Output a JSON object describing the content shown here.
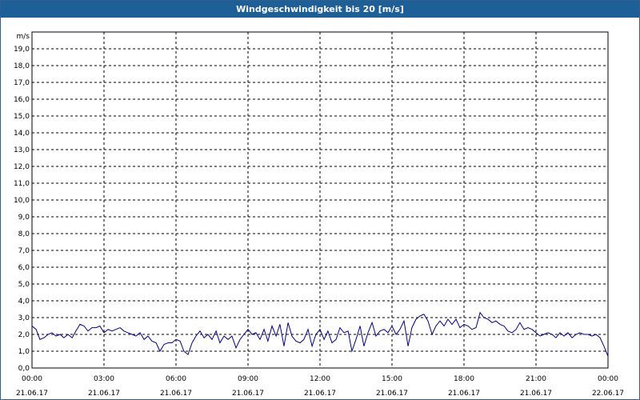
{
  "window": {
    "title": "Windgeschwindigkeit bis 20 [m/s]"
  },
  "colors": {
    "titlebar": "#1f5f97",
    "series": "#00008b",
    "grid": "#000000"
  },
  "chart_data": {
    "type": "line",
    "title": "Windgeschwindigkeit bis 20 [m/s]",
    "ylabel": "m/s",
    "ylim": [
      0,
      20
    ],
    "yticks": [
      "0,0",
      "1,0",
      "2,0",
      "3,0",
      "4,0",
      "5,0",
      "6,0",
      "7,0",
      "8,0",
      "9,0",
      "10,0",
      "11,0",
      "12,0",
      "13,0",
      "14,0",
      "15,0",
      "16,0",
      "17,0",
      "18,0",
      "19,0"
    ],
    "xlim_hours": [
      0,
      24
    ],
    "xticks": [
      {
        "time": "00:00",
        "date": "21.06.17"
      },
      {
        "time": "03:00",
        "date": "21.06.17"
      },
      {
        "time": "06:00",
        "date": "21.06.17"
      },
      {
        "time": "09:00",
        "date": "21.06.17"
      },
      {
        "time": "12:00",
        "date": "21.06.17"
      },
      {
        "time": "15:00",
        "date": "21.06.17"
      },
      {
        "time": "18:00",
        "date": "21.06.17"
      },
      {
        "time": "21:00",
        "date": "21.06.17"
      },
      {
        "time": "00:00",
        "date": "22.06.17"
      }
    ],
    "grid": true,
    "series": [
      {
        "x_hours": [
          0,
          0.17,
          0.33,
          0.5,
          0.67,
          0.83,
          1,
          1.17,
          1.33,
          1.5,
          1.67,
          1.83,
          2,
          2.17,
          2.33,
          2.5,
          2.67,
          2.83,
          3,
          3.17,
          3.33,
          3.5,
          3.67,
          3.83,
          4,
          4.17,
          4.33,
          4.5,
          4.67,
          4.83,
          5,
          5.17,
          5.33,
          5.5,
          5.67,
          5.83,
          6,
          6.17,
          6.33,
          6.5,
          6.67,
          6.83,
          7,
          7.17,
          7.33,
          7.5,
          7.67,
          7.83,
          8,
          8.17,
          8.33,
          8.5,
          8.67,
          8.83,
          9,
          9.17,
          9.33,
          9.5,
          9.67,
          9.83,
          10,
          10.17,
          10.33,
          10.5,
          10.67,
          10.83,
          11,
          11.17,
          11.33,
          11.5,
          11.67,
          11.83,
          12,
          12.17,
          12.33,
          12.5,
          12.67,
          12.83,
          13,
          13.17,
          13.33,
          13.5,
          13.67,
          13.83,
          14,
          14.17,
          14.33,
          14.5,
          14.67,
          14.83,
          15,
          15.17,
          15.33,
          15.5,
          15.67,
          15.83,
          16,
          16.17,
          16.33,
          16.5,
          16.67,
          16.83,
          17,
          17.17,
          17.33,
          17.5,
          17.67,
          17.83,
          18,
          18.17,
          18.33,
          18.5,
          18.67,
          18.83,
          19,
          19.17,
          19.33,
          19.5,
          19.67,
          19.83,
          20,
          20.17,
          20.33,
          20.5,
          20.67,
          20.83,
          21,
          21.17,
          21.33,
          21.5,
          21.67,
          21.83,
          22,
          22.17,
          22.33,
          22.5,
          22.67,
          22.83,
          23,
          23.17,
          23.33,
          23.5,
          23.67,
          23.83,
          24
        ],
        "y": [
          2.5,
          2.3,
          1.7,
          1.8,
          2.0,
          2.1,
          1.9,
          2.0,
          1.8,
          2.0,
          1.8,
          2.2,
          2.6,
          2.5,
          2.2,
          2.4,
          2.4,
          2.5,
          2.1,
          2.3,
          2.2,
          2.3,
          2.4,
          2.2,
          2.1,
          2.0,
          1.9,
          2.1,
          1.7,
          1.9,
          1.6,
          1.5,
          1.0,
          1.4,
          1.5,
          1.5,
          1.7,
          1.6,
          1.0,
          0.8,
          1.5,
          1.9,
          2.2,
          1.8,
          2.0,
          1.7,
          2.2,
          1.5,
          1.9,
          1.7,
          1.9,
          1.2,
          1.7,
          2.0,
          2.3,
          2.0,
          2.1,
          1.7,
          2.3,
          1.6,
          2.5,
          1.9,
          2.6,
          1.3,
          2.7,
          1.9,
          1.6,
          1.5,
          1.7,
          2.3,
          1.3,
          2.0,
          2.3,
          1.7,
          2.2,
          1.5,
          1.7,
          2.4,
          2.1,
          2.2,
          1.0,
          1.7,
          2.5,
          1.3,
          2.1,
          2.7,
          1.9,
          2.2,
          2.3,
          2.1,
          2.5,
          2.0,
          2.3,
          2.8,
          1.3,
          2.4,
          2.9,
          3.1,
          3.2,
          2.8,
          2.0,
          2.5,
          2.8,
          2.5,
          2.9,
          2.6,
          2.9,
          2.4,
          2.6,
          2.5,
          2.3,
          2.4,
          3.3,
          3.0,
          2.9,
          2.7,
          2.8,
          2.6,
          2.5,
          2.2,
          2.1,
          2.3,
          2.7,
          2.3,
          2.4,
          2.3,
          2.1,
          1.9,
          2.0,
          2.1,
          2.0,
          1.8,
          2.1,
          1.9,
          2.1,
          1.8,
          2.0,
          2.1,
          2.0,
          2.0,
          1.9,
          2.0,
          1.8,
          1.3,
          0.7
        ]
      }
    ]
  }
}
